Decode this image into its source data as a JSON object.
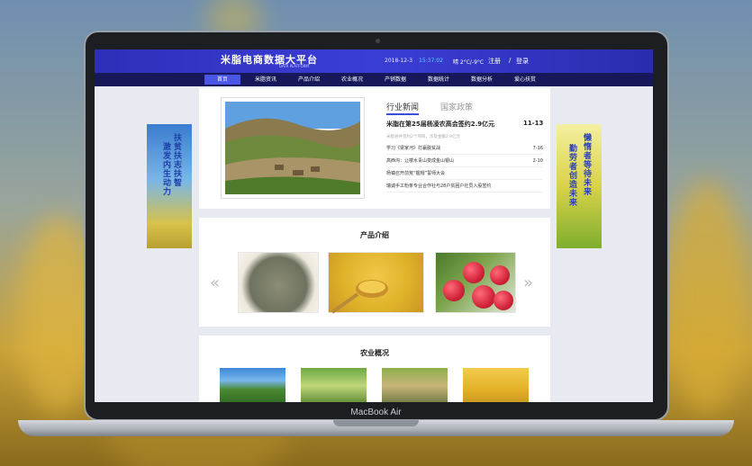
{
  "device": {
    "brand": "MacBook Air"
  },
  "header": {
    "title": "米脂电商数据大平台",
    "subtitle": "DATA PLATFORM",
    "date": "2018-12-3",
    "time": "15:37:02",
    "weather": "晴 2°C/-9°C",
    "register": "注册",
    "separator": "/",
    "login": "登录"
  },
  "nav": {
    "items": [
      "首页",
      "米脂资讯",
      "产品介绍",
      "农业概况",
      "产销数据",
      "数据统计",
      "数据分析",
      "爱心扶贫"
    ],
    "active_index": 0
  },
  "banners": {
    "left": {
      "line1": "扶贫扶志扶智",
      "line2_lead": "激",
      "line2": "发内生动力"
    },
    "right": {
      "line1": "懒惰者等待未来",
      "line2": "勤劳者创造未来"
    }
  },
  "news": {
    "tabs": [
      "行业新闻",
      "国家政策"
    ],
    "active_tab": 0,
    "headline": {
      "text": "米脂在第25届杨凌农高会签约2.9亿元",
      "date": "11-13"
    },
    "headline_desc": "米脂县共签约2个项目，涉及金额2.9亿元",
    "items": [
      {
        "text": "学习《梁家河》打赢脱贫战",
        "date": "7-16"
      },
      {
        "text": "高西沟：让楼水青山变成金山银山",
        "date": "2-10"
      },
      {
        "text": "杨镇召开前荒“握帽”誓师大会",
        "date": ""
      },
      {
        "text": "瑞诚手工粉条专业合作社与28户贫困户社员入股签约",
        "date": ""
      }
    ]
  },
  "products": {
    "title": "产品介绍",
    "prev_arrow": "«",
    "next_arrow": "»",
    "items": [
      "millet-pile",
      "millet-spoon",
      "apples"
    ]
  },
  "agriculture": {
    "title": "农业概况",
    "items": [
      "terraced-hills",
      "orchard-farmers",
      "corn-harvest",
      "millet-grains"
    ]
  },
  "colors": {
    "header_bg": "#3b3ed6",
    "nav_bg": "#16185a",
    "nav_active": "#4a56e6",
    "time_color": "#56d6ff",
    "tab_underline": "#3a4fd6"
  }
}
